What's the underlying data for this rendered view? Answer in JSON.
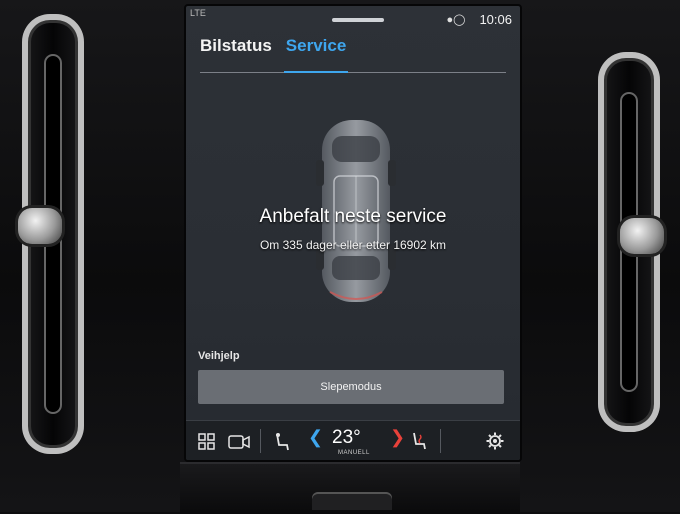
{
  "status": {
    "left_text": "LTE",
    "time": "10:06",
    "icon_profile": "profile-icon",
    "icon_signal": "signal-icon"
  },
  "tabs": [
    {
      "label": "Bilstatus",
      "active": false
    },
    {
      "label": "Service",
      "active": true
    }
  ],
  "service": {
    "headline": "Anbefalt neste service",
    "detail": "Om 335 dager eller etter 16902 km"
  },
  "roadside": {
    "section_title": "Veihjelp",
    "tow_button_label": "Slepemodus"
  },
  "climate": {
    "temperature": "23°",
    "mode": "MANUELL",
    "icons": [
      "app-grid-icon",
      "camera-icon",
      "seat-driver-icon",
      "seat-heat-icon",
      "settings-gear-icon"
    ]
  },
  "colors": {
    "accent_blue": "#3ea6ee",
    "accent_red": "#e8413a",
    "screen_bg": "#2d3137",
    "button_bg": "#6a6e74"
  }
}
